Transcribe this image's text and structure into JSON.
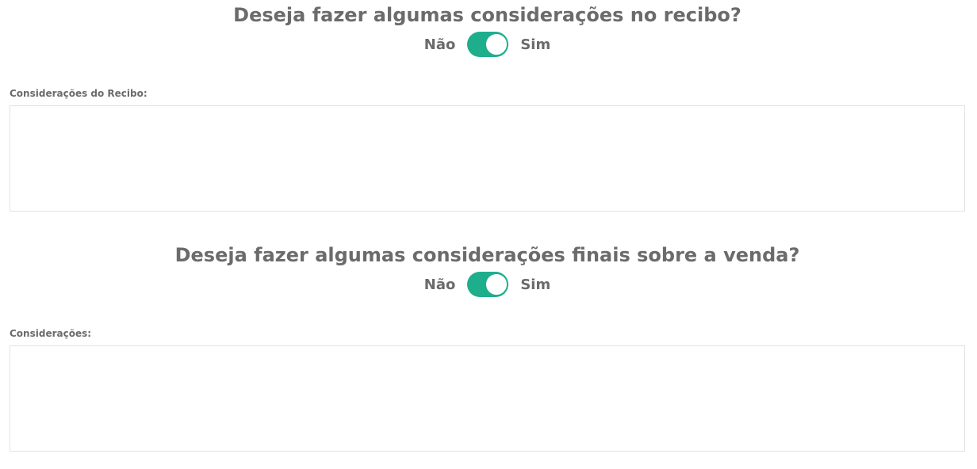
{
  "section_receipt": {
    "question": "Deseja fazer algumas considerações no recibo?",
    "toggle": {
      "off_label": "Não",
      "on_label": "Sim",
      "state": "on"
    },
    "field_label": "Considerações do Recibo:",
    "field_value": ""
  },
  "section_sale": {
    "question": "Deseja fazer algumas considerações finais sobre a venda?",
    "toggle": {
      "off_label": "Não",
      "on_label": "Sim",
      "state": "on"
    },
    "field_label": "Considerações:",
    "field_value": ""
  },
  "colors": {
    "accent": "#1fae8c",
    "text": "#6b6b6b",
    "border": "#e2e2e2"
  }
}
